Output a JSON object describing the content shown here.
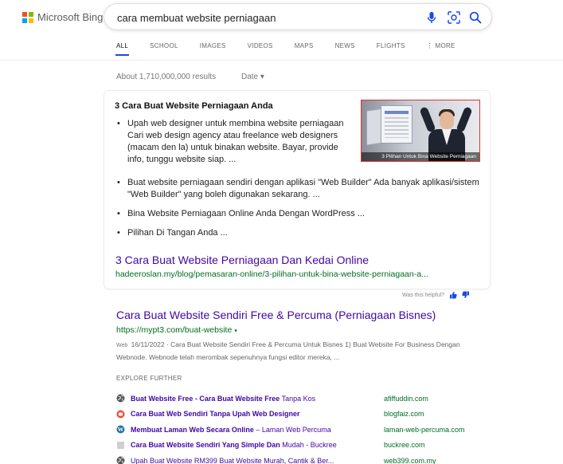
{
  "brand": {
    "name": "Microsoft Bing",
    "colors": [
      "#f25022",
      "#7fba00",
      "#00a4ef",
      "#ffb900"
    ]
  },
  "search": {
    "query": "cara membuat website perniagaan",
    "icons": [
      "microphone-icon",
      "visual-search-icon",
      "search-icon"
    ]
  },
  "tabs": [
    "ALL",
    "SCHOOL",
    "IMAGES",
    "VIDEOS",
    "MAPS",
    "NEWS",
    "FLIGHTS",
    "⋮ MORE"
  ],
  "results_meta": {
    "count": "About 1,710,000,000 results",
    "date_filter": "Date ▾"
  },
  "answer_card": {
    "title": "3 Cara Buat Website Perniagaan Anda",
    "bullets": [
      "Upah web designer untuk membina website perniagaan Cari web design agency atau freelance web designers (macam den la) untuk binakan website. Bayar, provide info, tunggu website siap. ...",
      "Buat website perniagaan sendiri dengan aplikasi \"Web Builder\" Ada banyak aplikasi/sistem \"Web Builder\" yang boleh digunakan sekarang. ...",
      "Bina Website Perniagaan Online Anda Dengan WordPress ...",
      "Pilihan Di Tangan Anda ..."
    ],
    "image_caption": "3 Pilihan Untuk Bina Website Perniagaan",
    "link_title": "3 Cara Buat Website Perniagaan Dan Kedai Online",
    "link_url": "hadeeroslan.my/blog/pemasaran-online/3-pilihan-untuk-bina-website-perniagaan-a..."
  },
  "feedback": {
    "label": "Was this helpful?"
  },
  "result2": {
    "title": "Cara Buat Website Sendiri Free & Percuma (Perniagaan Bisnes)",
    "url": "https://mypt3.com/buat-website",
    "caret": "▾",
    "tag": "Web",
    "snippet": "16/11/2022 · Cara Buat Website Sendiri Free & Percuma Untuk Bisnes 1) Buat Website For Business Dengan Webnode. Webnode telah merombak sepenuhnya fungsi editor mereka, ..."
  },
  "explore": {
    "heading": "EXPLORE FURTHER",
    "items": [
      {
        "bold": "Buat Website Free - Cara Buat Website Free",
        "rest": " Tanpa Kos",
        "domain": "afiffuddin.com",
        "icon": "globe-icon"
      },
      {
        "bold": "Cara Buat Web Sendiri Tanpa Upah Web Designer",
        "rest": "",
        "domain": "blogfaiz.com",
        "icon": "blog-favicon-icon"
      },
      {
        "bold": "Membuat Laman Web Secara Online",
        "rest": " – Laman Web Percuma",
        "domain": "laman-web-percuma.com",
        "icon": "wordpress-icon"
      },
      {
        "bold": "Cara Buat Website Sendiri Yang Simple Dan",
        "rest": " Mudah - Buckree",
        "domain": "buckree.com",
        "icon": "page-icon"
      },
      {
        "bold": "",
        "rest": "Upah Buat Website RM399 Buat Website Murah, Cantik & Ber...",
        "domain": "web399.com.my",
        "icon": "globe-icon"
      }
    ]
  }
}
